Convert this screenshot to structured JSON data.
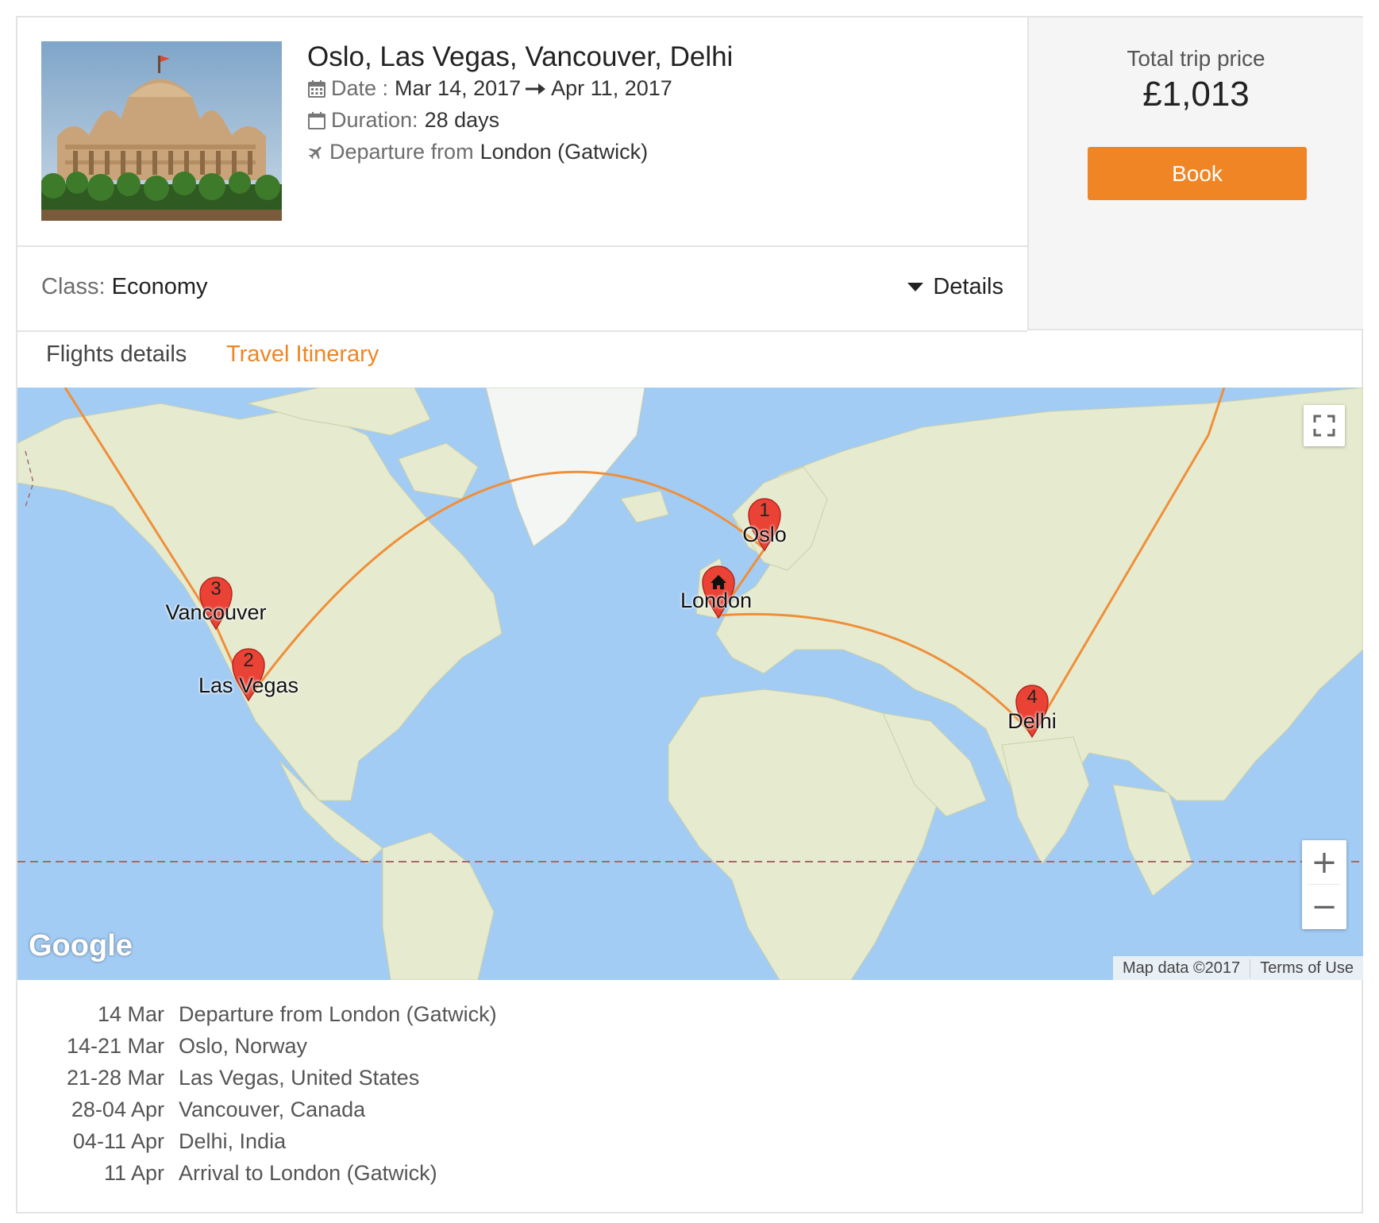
{
  "trip": {
    "title": "Oslo, Las Vegas, Vancouver, Delhi",
    "date_label": "Date :",
    "date_start": "Mar 14, 2017",
    "date_end": "Apr 11, 2017",
    "duration_label": "Duration:",
    "duration_value": "28 days",
    "departure_label": "Departure from",
    "departure_value": "London (Gatwick)",
    "class_label": "Class:",
    "class_value": "Economy",
    "details_label": "Details"
  },
  "price": {
    "label": "Total trip price",
    "value": "£1,013",
    "book_label": "Book"
  },
  "tabs": [
    {
      "label": "Flights details",
      "active": false
    },
    {
      "label": "Travel Itinerary",
      "active": true
    }
  ],
  "map": {
    "markers": [
      {
        "number": "1",
        "label": "Oslo"
      },
      {
        "number": "2",
        "label": "Las Vegas"
      },
      {
        "number": "3",
        "label": "Vancouver"
      },
      {
        "number": "4",
        "label": "Delhi"
      },
      {
        "number": "",
        "label": "London",
        "icon": "home-icon"
      }
    ],
    "brand": "Google",
    "map_data": "Map data ©2017",
    "terms": "Terms of Use",
    "zoom_in": "+",
    "zoom_out": "−",
    "route_color": "#ef8f3a",
    "marker_color": "#ea4335"
  },
  "itinerary": [
    {
      "date": "14 Mar",
      "place": "Departure from London (Gatwick)"
    },
    {
      "date": "14-21 Mar",
      "place": "Oslo, Norway"
    },
    {
      "date": "21-28 Mar",
      "place": "Las Vegas, United States"
    },
    {
      "date": "28-04 Apr",
      "place": "Vancouver, Canada"
    },
    {
      "date": "04-11 Apr",
      "place": "Delhi, India"
    },
    {
      "date": "11 Apr",
      "place": "Arrival to London (Gatwick)"
    }
  ],
  "colors": {
    "accent": "#ef8524",
    "border": "#e3e3e3",
    "price_bg": "#f5f5f5",
    "water": "#a3ccf4",
    "land": "#e8ecd6"
  }
}
